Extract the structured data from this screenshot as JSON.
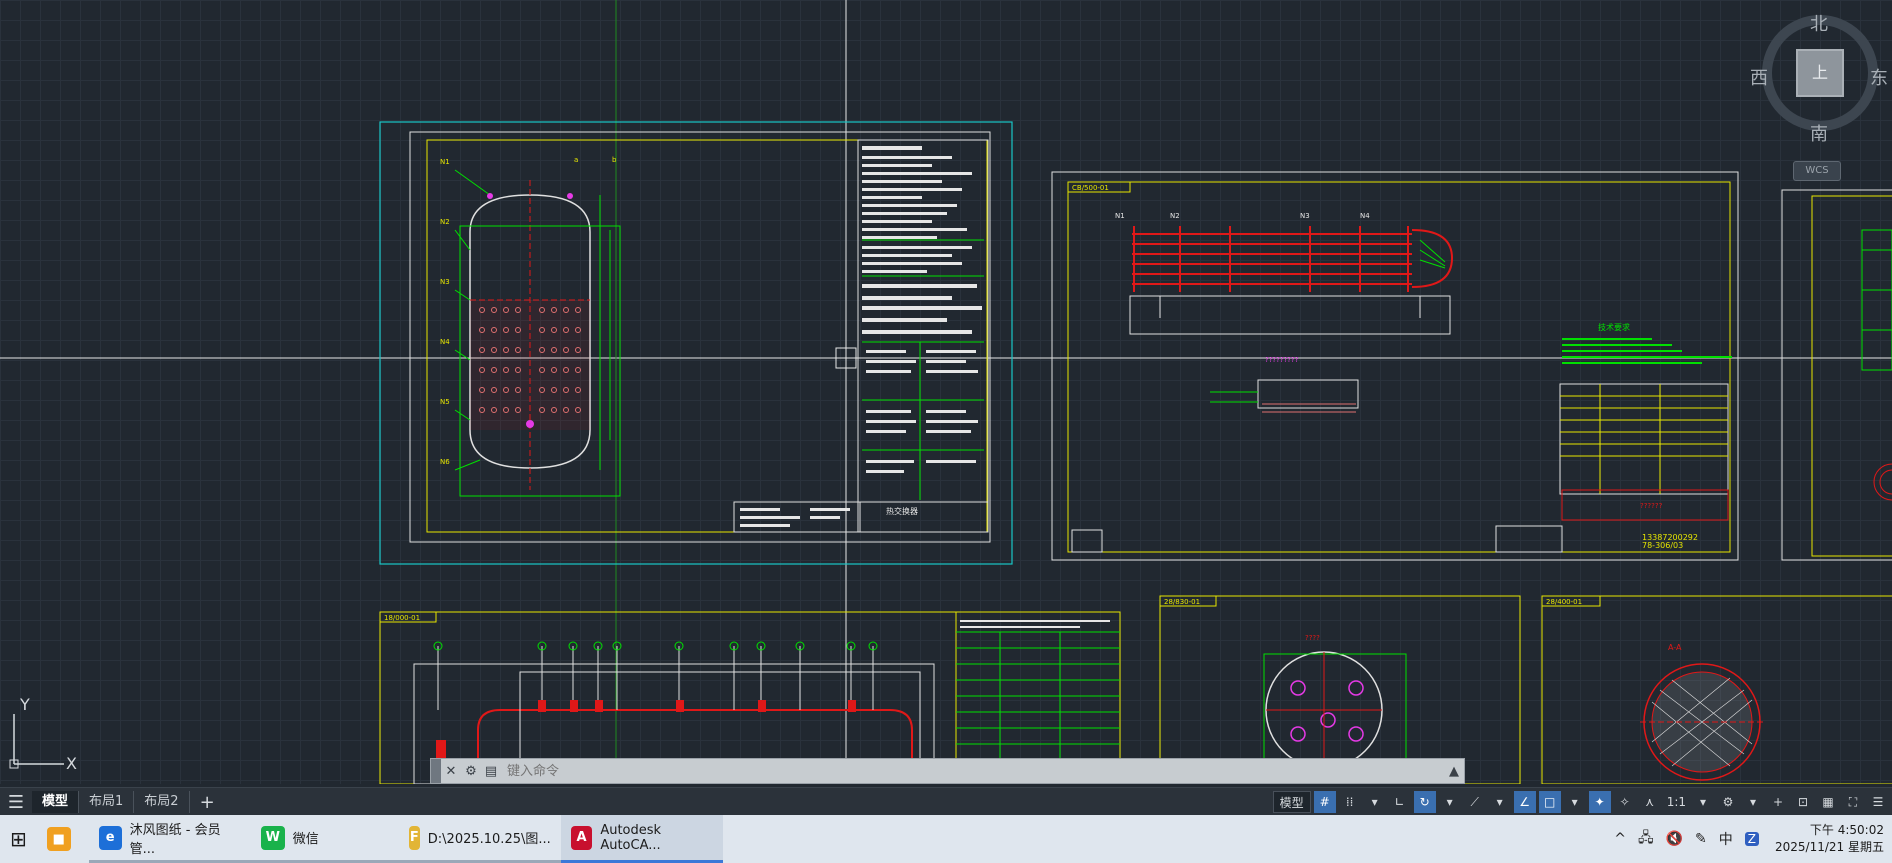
{
  "viewcube": {
    "north": "北",
    "south": "南",
    "west": "西",
    "east": "东",
    "face": "上",
    "wcs": "WCS"
  },
  "ucs": {
    "y": "Y",
    "x": "X"
  },
  "command_line": {
    "placeholder": "键入命令"
  },
  "layout_tabs": {
    "tabs": [
      {
        "label": "模型",
        "active": true
      },
      {
        "label": "布局1",
        "active": false
      },
      {
        "label": "布局2",
        "active": false
      }
    ],
    "add": "+"
  },
  "status_bar": {
    "model": "模型",
    "scale": "1:1"
  },
  "drawing_labels": {
    "sheet1_title": "热交换器",
    "sheet2_tag": "CB/500-01",
    "sheet2_note": "技术要求",
    "sheet2_phone": "13387200292",
    "sheet2_code": "78-306/03",
    "sheet3_tag": "18/000-01",
    "sheet4_tag": "28/830-01",
    "sheet5_tag": "28/400-01",
    "sheet5_section": "A-A"
  },
  "taskbar": {
    "apps": [
      {
        "label": "沐风图纸 - 会员管...",
        "icon": "e",
        "color": "#1d6fd8"
      },
      {
        "label": "微信",
        "icon": "W",
        "color": "#19b24b"
      },
      {
        "label": "D:\\2025.10.25\\图...",
        "icon": "F",
        "color": "#e2b536"
      },
      {
        "label": "Autodesk AutoCA...",
        "icon": "A",
        "color": "#c8102e"
      }
    ],
    "tray": {
      "ime": "中",
      "time": "下午 4:50:02",
      "date": "2025/11/21 星期五"
    }
  },
  "colors": {
    "background": "#212830",
    "accent": "#3a6fb0",
    "cad_yellow": "#e6e600",
    "cad_green": "#00e000",
    "cad_red": "#e01818",
    "cad_cyan": "#00d8d8"
  }
}
